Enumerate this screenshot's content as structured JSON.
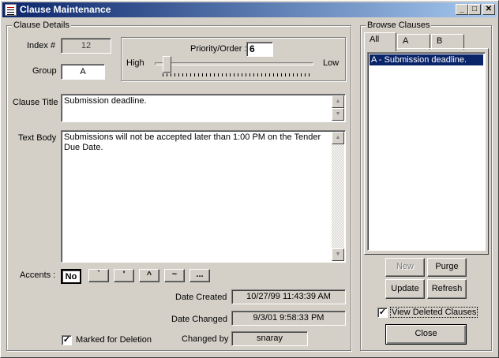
{
  "window": {
    "title": "Clause Maintenance",
    "controls": {
      "minimize": "_",
      "maximize": "□",
      "close": "✕"
    }
  },
  "details": {
    "group_title": "Clause Details",
    "index_label": "Index #",
    "index_value": "12",
    "group_label": "Group",
    "group_value": "A",
    "priority_label": "Priority/Order :",
    "priority_value": "6",
    "slider_high": "High",
    "slider_low": "Low",
    "slider_level_fraction": 0.05,
    "clause_title_label": "Clause Title",
    "clause_title_value": "Submission deadline.",
    "text_body_label": "Text Body",
    "text_body_value": "Submissions will not be accepted  later than 1:00 PM on the Tender Due Date.",
    "accents_label": "Accents :",
    "accents": [
      "No",
      "`",
      "'",
      "^",
      "~",
      "..."
    ],
    "date_created_label": "Date Created",
    "date_created_value": "10/27/99 11:43:39 AM",
    "date_changed_label": "Date Changed",
    "date_changed_value": "9/3/01 9:58:33 PM",
    "changed_by_label": "Changed by",
    "changed_by_value": "snaray",
    "marked_deletion_label": "Marked for Deletion",
    "marked_deletion_checked": true
  },
  "browse": {
    "group_title": "Browse Clauses",
    "tabs": [
      "All",
      "A",
      "B"
    ],
    "active_tab": "All",
    "items": [
      "A - Submission deadline."
    ],
    "buttons": {
      "new": "New",
      "purge": "Purge",
      "update": "Update",
      "refresh": "Refresh",
      "close": "Close"
    },
    "view_deleted_label": "View Deleted Clauses",
    "view_deleted_checked": true
  },
  "colors": {
    "titlebar_start": "#0a246a",
    "titlebar_end": "#a6caf0",
    "selection": "#0a246a",
    "face": "#d4d0c8"
  }
}
